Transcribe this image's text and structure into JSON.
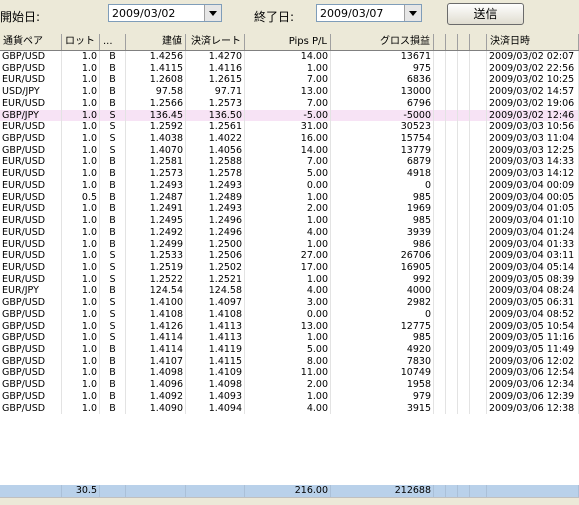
{
  "toolbar": {
    "start_label": "開始日:",
    "start_date": "2009/03/02",
    "end_label": "終了日:",
    "end_date": "2009/03/07",
    "send_label": "送信"
  },
  "columns": [
    "通貨ペア",
    "ロット",
    "...",
    "建値",
    "決済レート",
    "Pips P/L",
    "グロス損益",
    "",
    "",
    "",
    "",
    "決済日時"
  ],
  "rows": [
    [
      "GBP/USD",
      "1.0",
      "B",
      "1.4256",
      "1.4270",
      "14.00",
      "13671",
      "2009/03/02 02:07"
    ],
    [
      "GBP/USD",
      "1.0",
      "B",
      "1.4115",
      "1.4116",
      "1.00",
      "975",
      "2009/03/02 22:56"
    ],
    [
      "EUR/USD",
      "1.0",
      "B",
      "1.2608",
      "1.2615",
      "7.00",
      "6836",
      "2009/03/02 10:25"
    ],
    [
      "USD/JPY",
      "1.0",
      "B",
      "97.58",
      "97.71",
      "13.00",
      "13000",
      "2009/03/02 14:57"
    ],
    [
      "EUR/USD",
      "1.0",
      "B",
      "1.2566",
      "1.2573",
      "7.00",
      "6796",
      "2009/03/02 19:06"
    ],
    [
      "GBP/JPY",
      "1.0",
      "S",
      "136.45",
      "136.50",
      "-5.00",
      "-5000",
      "2009/03/02 12:46"
    ],
    [
      "EUR/USD",
      "1.0",
      "S",
      "1.2592",
      "1.2561",
      "31.00",
      "30523",
      "2009/03/03 10:56"
    ],
    [
      "GBP/USD",
      "1.0",
      "S",
      "1.4038",
      "1.4022",
      "16.00",
      "15754",
      "2009/03/03 11:04"
    ],
    [
      "GBP/USD",
      "1.0",
      "S",
      "1.4070",
      "1.4056",
      "14.00",
      "13779",
      "2009/03/03 12:25"
    ],
    [
      "EUR/USD",
      "1.0",
      "B",
      "1.2581",
      "1.2588",
      "7.00",
      "6879",
      "2009/03/03 14:33"
    ],
    [
      "EUR/USD",
      "1.0",
      "B",
      "1.2573",
      "1.2578",
      "5.00",
      "4918",
      "2009/03/03 14:12"
    ],
    [
      "EUR/USD",
      "1.0",
      "B",
      "1.2493",
      "1.2493",
      "0.00",
      "0",
      "2009/03/04 00:09"
    ],
    [
      "EUR/USD",
      "0.5",
      "B",
      "1.2487",
      "1.2489",
      "1.00",
      "985",
      "2009/03/04 00:05"
    ],
    [
      "EUR/USD",
      "1.0",
      "B",
      "1.2491",
      "1.2493",
      "2.00",
      "1969",
      "2009/03/04 01:05"
    ],
    [
      "EUR/USD",
      "1.0",
      "B",
      "1.2495",
      "1.2496",
      "1.00",
      "985",
      "2009/03/04 01:10"
    ],
    [
      "EUR/USD",
      "1.0",
      "B",
      "1.2492",
      "1.2496",
      "4.00",
      "3939",
      "2009/03/04 01:24"
    ],
    [
      "EUR/USD",
      "1.0",
      "B",
      "1.2499",
      "1.2500",
      "1.00",
      "986",
      "2009/03/04 01:33"
    ],
    [
      "EUR/USD",
      "1.0",
      "S",
      "1.2533",
      "1.2506",
      "27.00",
      "26706",
      "2009/03/04 03:11"
    ],
    [
      "EUR/USD",
      "1.0",
      "S",
      "1.2519",
      "1.2502",
      "17.00",
      "16905",
      "2009/03/04 05:14"
    ],
    [
      "EUR/USD",
      "1.0",
      "S",
      "1.2522",
      "1.2521",
      "1.00",
      "992",
      "2009/03/05 08:39"
    ],
    [
      "EUR/JPY",
      "1.0",
      "B",
      "124.54",
      "124.58",
      "4.00",
      "4000",
      "2009/03/04 08:24"
    ],
    [
      "GBP/USD",
      "1.0",
      "S",
      "1.4100",
      "1.4097",
      "3.00",
      "2982",
      "2009/03/05 06:31"
    ],
    [
      "GBP/USD",
      "1.0",
      "S",
      "1.4108",
      "1.4108",
      "0.00",
      "0",
      "2009/03/04 08:52"
    ],
    [
      "GBP/USD",
      "1.0",
      "S",
      "1.4126",
      "1.4113",
      "13.00",
      "12775",
      "2009/03/05 10:54"
    ],
    [
      "GBP/USD",
      "1.0",
      "S",
      "1.4114",
      "1.4113",
      "1.00",
      "985",
      "2009/03/05 11:16"
    ],
    [
      "GBP/USD",
      "1.0",
      "B",
      "1.4114",
      "1.4119",
      "5.00",
      "4920",
      "2009/03/05 11:49"
    ],
    [
      "GBP/USD",
      "1.0",
      "B",
      "1.4107",
      "1.4115",
      "8.00",
      "7830",
      "2009/03/06 12:02"
    ],
    [
      "GBP/USD",
      "1.0",
      "B",
      "1.4098",
      "1.4109",
      "11.00",
      "10749",
      "2009/03/06 12:54"
    ],
    [
      "GBP/USD",
      "1.0",
      "B",
      "1.4096",
      "1.4098",
      "2.00",
      "1958",
      "2009/03/06 12:34"
    ],
    [
      "GBP/USD",
      "1.0",
      "B",
      "1.4092",
      "1.4093",
      "1.00",
      "979",
      "2009/03/06 12:39"
    ],
    [
      "GBP/USD",
      "1.0",
      "B",
      "1.4090",
      "1.4094",
      "4.00",
      "3915",
      "2009/03/06 12:38"
    ]
  ],
  "highlight_row": 5,
  "totals": {
    "lot": "30.5",
    "pips": "216.00",
    "gross": "212688"
  }
}
